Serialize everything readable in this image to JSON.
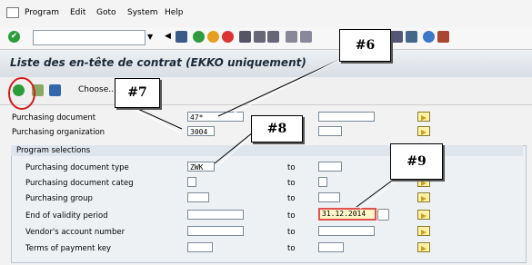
{
  "menu": {
    "items": [
      "Program",
      "Edit",
      "Goto",
      "System",
      "Help"
    ]
  },
  "toolbar": {
    "command_value": ""
  },
  "title": "Liste des en-tête de contrat (EKKO uniquement)",
  "app_toolbar": {
    "choose_label": "Choose..."
  },
  "fields": {
    "purchasing_document": {
      "label": "Purchasing document",
      "low": "47*",
      "high": ""
    },
    "purchasing_organization": {
      "label": "Purchasing organization",
      "low": "3004",
      "high": ""
    }
  },
  "program_selections": {
    "title": "Program selections",
    "rows": [
      {
        "label": "Purchasing document type",
        "low": "ZWK",
        "to": "to",
        "high": ""
      },
      {
        "label": "Purchasing document categ",
        "low": "",
        "to": "to",
        "high": ""
      },
      {
        "label": "Purchasing group",
        "low": "",
        "to": "to",
        "high": ""
      },
      {
        "label": "End of validity period",
        "low": "",
        "to": "to",
        "high": "31.12.2014"
      },
      {
        "label": "Vendor's account number",
        "low": "",
        "to": "to",
        "high": ""
      },
      {
        "label": "Terms of payment key",
        "low": "",
        "to": "to",
        "high": ""
      }
    ]
  },
  "callouts": [
    "#6",
    "#7",
    "#8",
    "#9"
  ]
}
